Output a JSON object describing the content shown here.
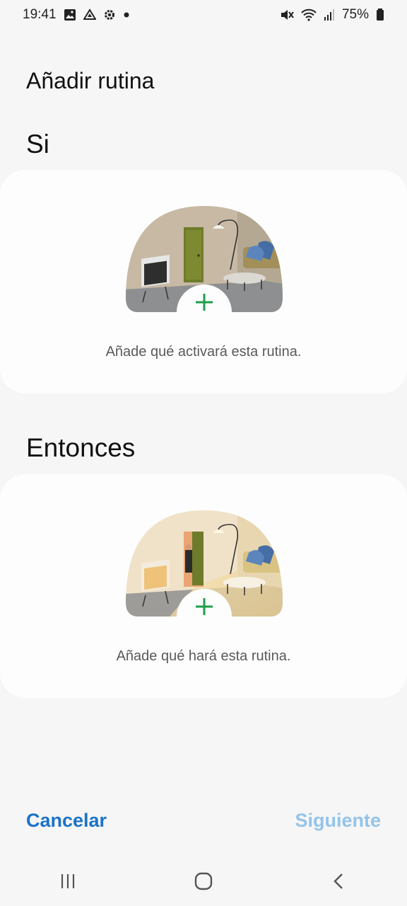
{
  "status_bar": {
    "time": "19:41",
    "battery": "75%",
    "left_icons": [
      "image-icon",
      "drive-icon",
      "settings-icon",
      "dot-icon"
    ],
    "right_icons": [
      "mute-icon",
      "wifi-icon",
      "signal-icon",
      "battery-icon"
    ]
  },
  "page": {
    "title": "Añadir rutina"
  },
  "if_section": {
    "label": "Si",
    "card_text": "Añade qué activará esta rutina."
  },
  "then_section": {
    "label": "Entonces",
    "card_text": "Añade qué hará esta rutina."
  },
  "footer": {
    "cancel_label": "Cancelar",
    "next_label": "Siguiente"
  },
  "colors": {
    "accent": "#1a73c8",
    "disabled_accent": "#94c4ea",
    "plus": "#1e9e4c"
  },
  "nav_bar": {
    "icons": [
      "recent-apps-icon",
      "home-icon",
      "back-icon"
    ]
  }
}
